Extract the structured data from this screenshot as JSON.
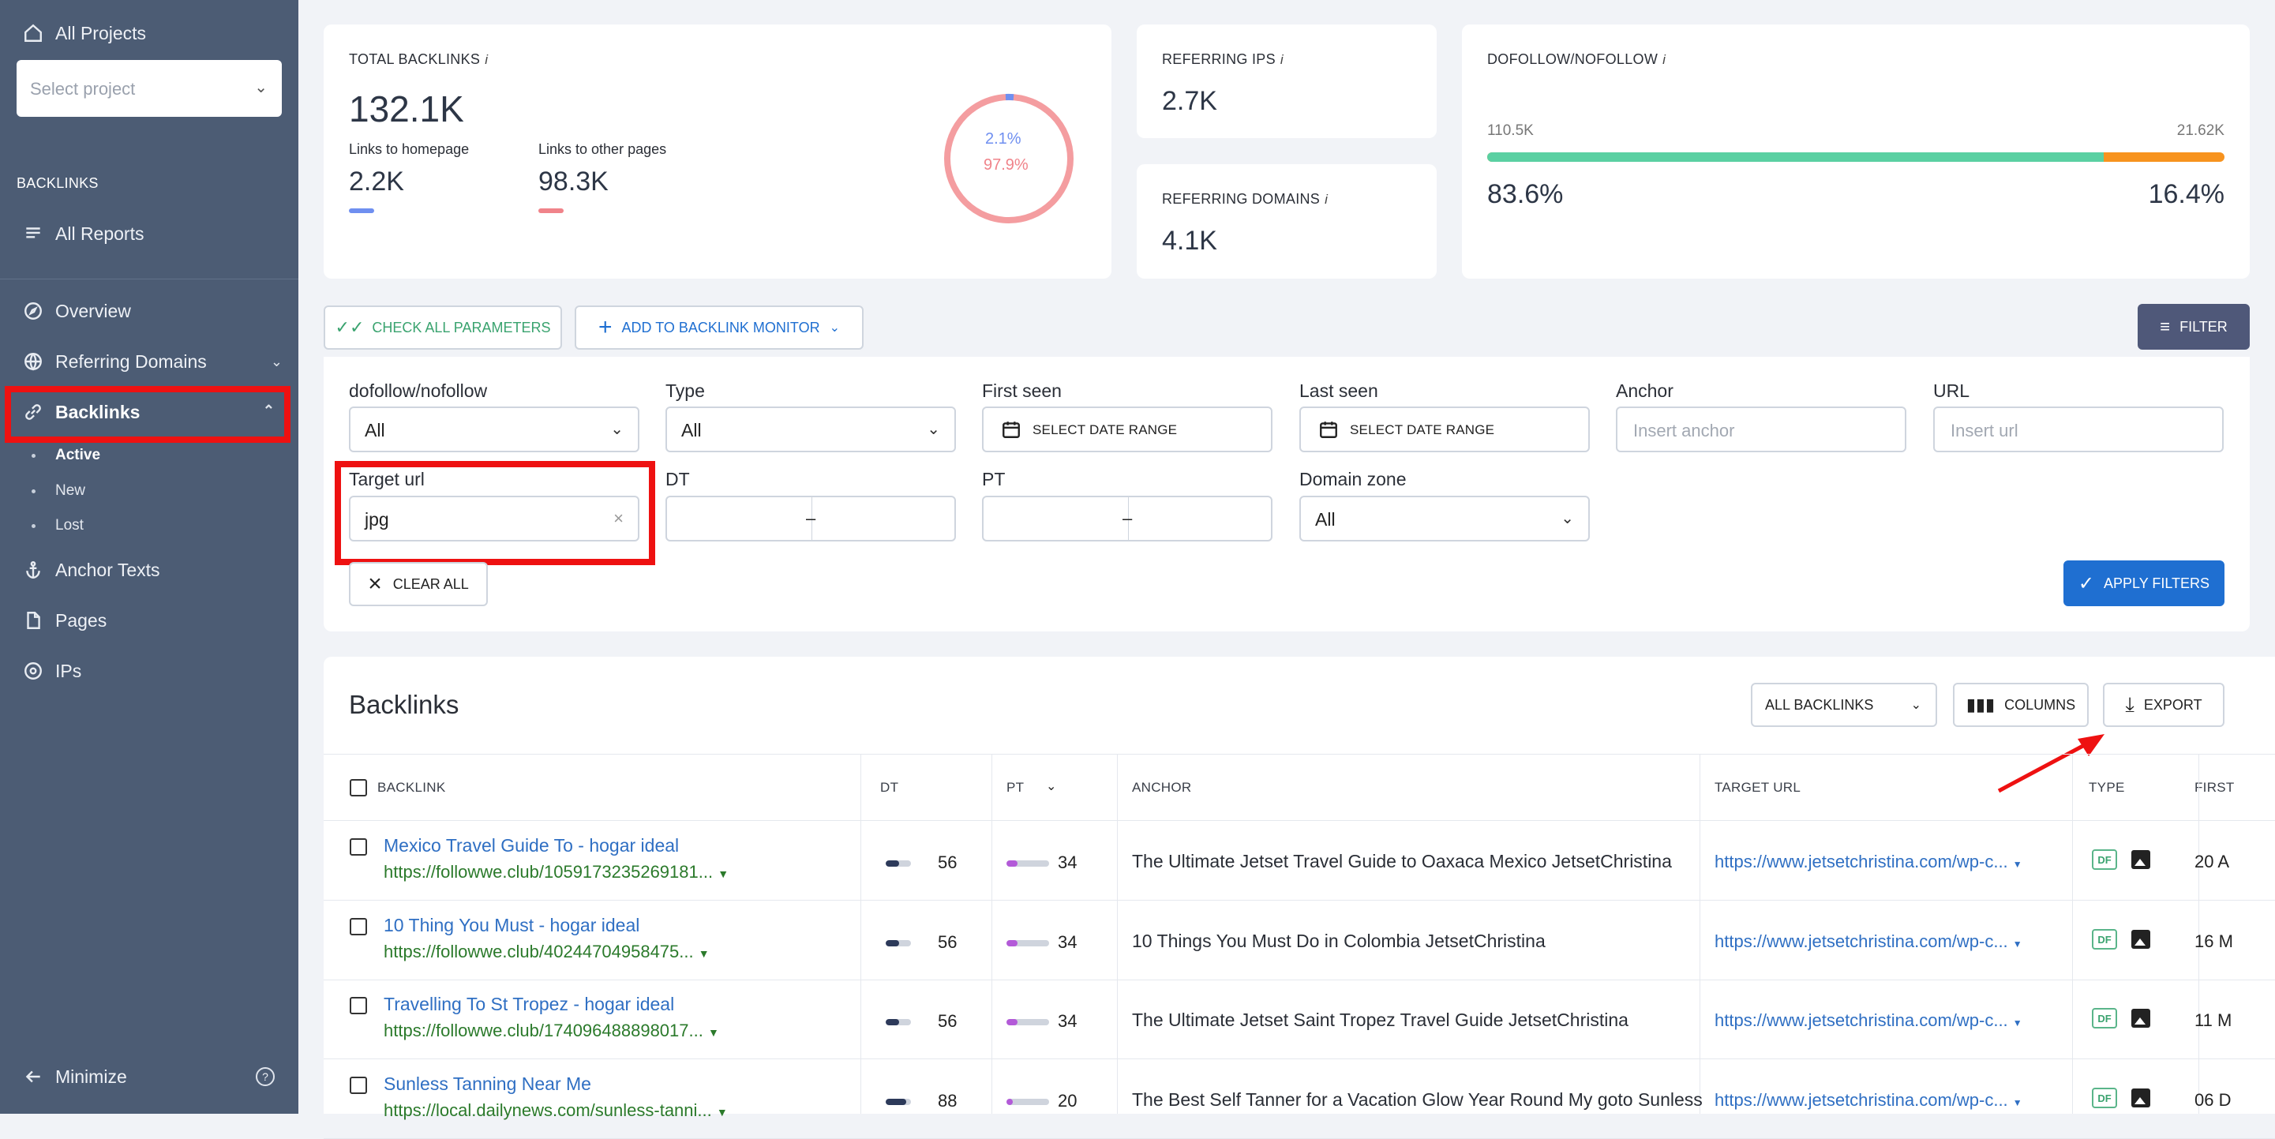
{
  "sidebar": {
    "all_projects": "All Projects",
    "select_project_placeholder": "Select project",
    "section_label": "BACKLINKS",
    "all_reports": "All Reports",
    "overview": "Overview",
    "referring_domains": "Referring Domains",
    "backlinks": "Backlinks",
    "sub": [
      "Active",
      "New",
      "Lost"
    ],
    "anchor_texts": "Anchor Texts",
    "pages": "Pages",
    "ips": "IPs",
    "minimize": "Minimize"
  },
  "stats": {
    "total_backlinks_label": "TOTAL BACKLINKS",
    "total_backlinks": "132.1K",
    "homepage_label": "Links to homepage",
    "homepage_value": "2.2K",
    "other_label": "Links to other pages",
    "other_value": "98.3K",
    "donut_blue": "2.1%",
    "donut_red": "97.9%",
    "referring_ips_label": "REFERRING IPS",
    "referring_ips": "2.7K",
    "referring_domains_label": "REFERRING DOMAINS",
    "referring_domains": "4.1K",
    "dofollow_label": "DOFOLLOW/NOFOLLOW",
    "dofollow_count": "110.5K",
    "nofollow_count": "21.62K",
    "dofollow_pct": "83.6%",
    "nofollow_pct": "16.4%",
    "dofollow_fraction": 0.836
  },
  "toolbar": {
    "check_all": "CHECK ALL PARAMETERS",
    "add_monitor": "ADD TO BACKLINK MONITOR",
    "filter": "FILTER"
  },
  "filters": {
    "dofollow_label": "dofollow/nofollow",
    "dofollow_value": "All",
    "type_label": "Type",
    "type_value": "All",
    "first_seen_label": "First seen",
    "first_seen_value": "SELECT DATE RANGE",
    "last_seen_label": "Last seen",
    "last_seen_value": "SELECT DATE RANGE",
    "anchor_label": "Anchor",
    "anchor_placeholder": "Insert anchor",
    "url_label": "URL",
    "url_placeholder": "Insert url",
    "target_url_label": "Target url",
    "target_url_value": "jpg",
    "dt_label": "DT",
    "pt_label": "PT",
    "domain_zone_label": "Domain zone",
    "domain_zone_value": "All",
    "clear_all": "CLEAR ALL",
    "apply": "APPLY FILTERS"
  },
  "table": {
    "title": "Backlinks",
    "all_backlinks": "ALL BACKLINKS",
    "columns_btn": "COLUMNS",
    "export_btn": "EXPORT",
    "headers": [
      "BACKLINK",
      "DT",
      "PT",
      "ANCHOR",
      "TARGET URL",
      "TYPE",
      "FIRST"
    ],
    "rows": [
      {
        "title": "Mexico Travel Guide To - hogar ideal",
        "url": "https://followwe.club/1059173235269181...",
        "dt": "56",
        "pt": "34",
        "anchor": "The Ultimate Jetset Travel Guide to Oaxaca Mexico JetsetChristina",
        "target": "https://www.jetsetchristina.com/wp-c...",
        "type": "DF",
        "first": "20 A"
      },
      {
        "title": "10 Thing You Must - hogar ideal",
        "url": "https://followwe.club/40244704958475...",
        "dt": "56",
        "pt": "34",
        "anchor": "10 Things You Must Do in Colombia JetsetChristina",
        "target": "https://www.jetsetchristina.com/wp-c...",
        "type": "DF",
        "first": "16 M"
      },
      {
        "title": "Travelling To St Tropez - hogar ideal",
        "url": "https://followwe.club/174096488898017...",
        "dt": "56",
        "pt": "34",
        "anchor": "The Ultimate Jetset Saint Tropez Travel Guide JetsetChristina",
        "target": "https://www.jetsetchristina.com/wp-c...",
        "type": "DF",
        "first": "11 M"
      },
      {
        "title": "Sunless Tanning Near Me",
        "url": "https://local.dailynews.com/sunless-tanni...",
        "dt": "88",
        "pt": "20",
        "anchor": "The Best Self Tanner for a Vacation Glow Year Round My goto Sunless",
        "target": "https://www.jetsetchristina.com/wp-c...",
        "type": "DF",
        "first": "06 D"
      }
    ]
  },
  "colors": {
    "sidebar": "#4c5c74",
    "accent_blue": "#1f6fd1",
    "dofollow": "#5ad0a2",
    "nofollow": "#f7931e",
    "highlight": "#e11111"
  }
}
